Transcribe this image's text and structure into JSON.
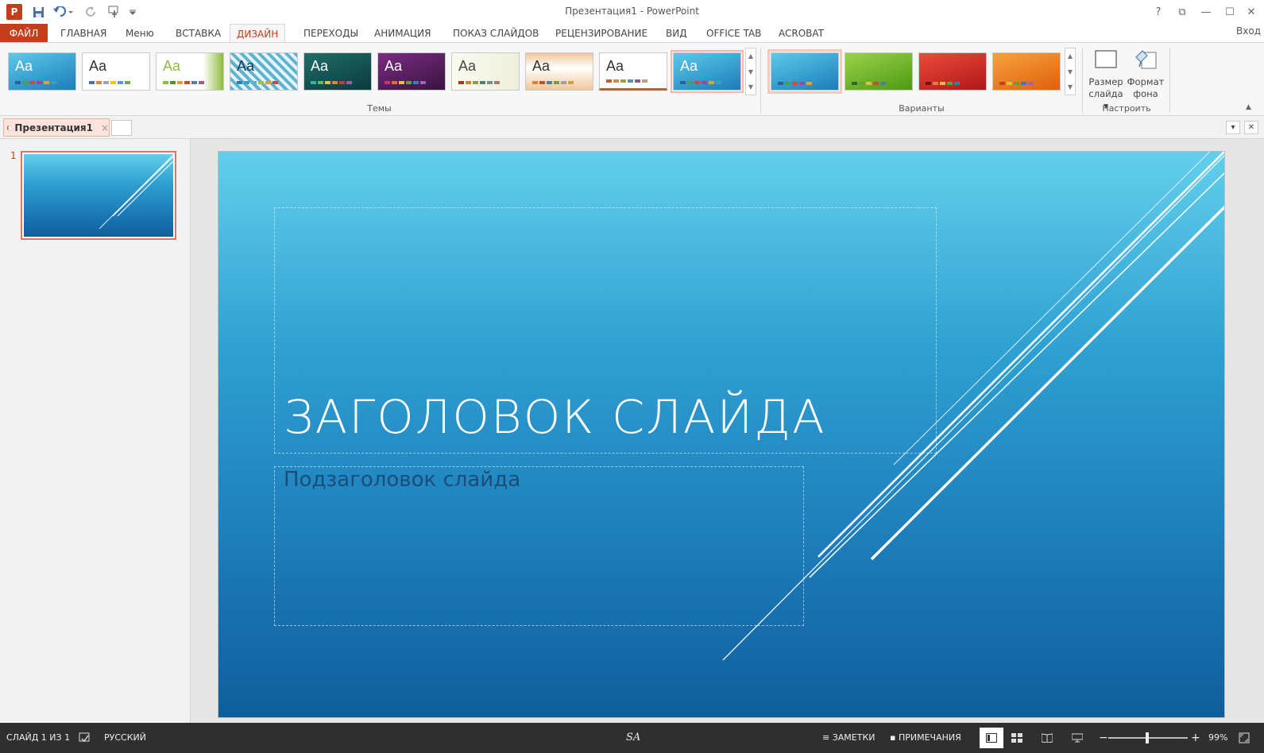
{
  "window": {
    "title": "Презентация1 - PowerPoint",
    "app_icon": "P",
    "signin": "Вход",
    "help": "?",
    "restore_ribbon": "⧉",
    "minimize": "—",
    "maximize": "☐",
    "close": "✕"
  },
  "quick_access": {
    "save_icon": "save-icon",
    "undo_icon": "undo-icon",
    "redo_icon": "redo-icon",
    "touch_icon": "touch-mode-icon",
    "customize_icon": "customize-icon"
  },
  "tabs": [
    "ФАЙЛ",
    "ГЛАВНАЯ",
    "Меню",
    "ВСТАВКА",
    "ДИЗАЙН",
    "ПЕРЕХОДЫ",
    "АНИМАЦИЯ",
    "ПОКАЗ СЛАЙДОВ",
    "РЕЦЕНЗИРОВАНИЕ",
    "ВИД",
    "OFFICE TAB",
    "ACROBAT"
  ],
  "active_tab": "ДИЗАЙН",
  "ribbon": {
    "themes_label": "Темы",
    "themes": [
      {
        "label": "Aa",
        "text_color": "#ffffff"
      },
      {
        "label": "Aa",
        "text_color": "#333333"
      },
      {
        "label": "Aa",
        "text_color": "#8dbb3f"
      },
      {
        "label": "Aa",
        "text_color": "#1a3a5a"
      },
      {
        "label": "Aa",
        "text_color": "#ffffff"
      },
      {
        "label": "Aa",
        "text_color": "#ffffff"
      },
      {
        "label": "Aa",
        "text_color": "#444444"
      },
      {
        "label": "Aa",
        "text_color": "#333333"
      },
      {
        "label": "Aa",
        "text_color": "#333333"
      },
      {
        "label": "Aa",
        "text_color": "#ffffff"
      }
    ],
    "variants_label": "Варианты",
    "customize_label": "Настроить",
    "slide_size_label_1": "Размер",
    "slide_size_label_2": "слайда",
    "format_bg_label_1": "Формат",
    "format_bg_label_2": "фона",
    "colors": {
      "accent": "#c43e1c",
      "selected_outline": "#f4b8a6"
    }
  },
  "document_tab": {
    "label": "Презентация1",
    "close": "×"
  },
  "doc_controls": {
    "dropdown": "▾",
    "close": "✕"
  },
  "thumbnails": [
    {
      "number": "1"
    }
  ],
  "slide": {
    "title": "ЗАГОЛОВОК СЛАЙДА",
    "subtitle": "Подзаголовок слайда"
  },
  "status_bar": {
    "slide_info": "СЛАЙД 1 ИЗ 1",
    "language": "РУССКИЙ",
    "center_mark": "SA",
    "notes": "ЗАМЕТКИ",
    "comments": "ПРИМЕЧАНИЯ",
    "zoom_minus": "−",
    "zoom_plus": "+",
    "zoom_level": "99%"
  }
}
